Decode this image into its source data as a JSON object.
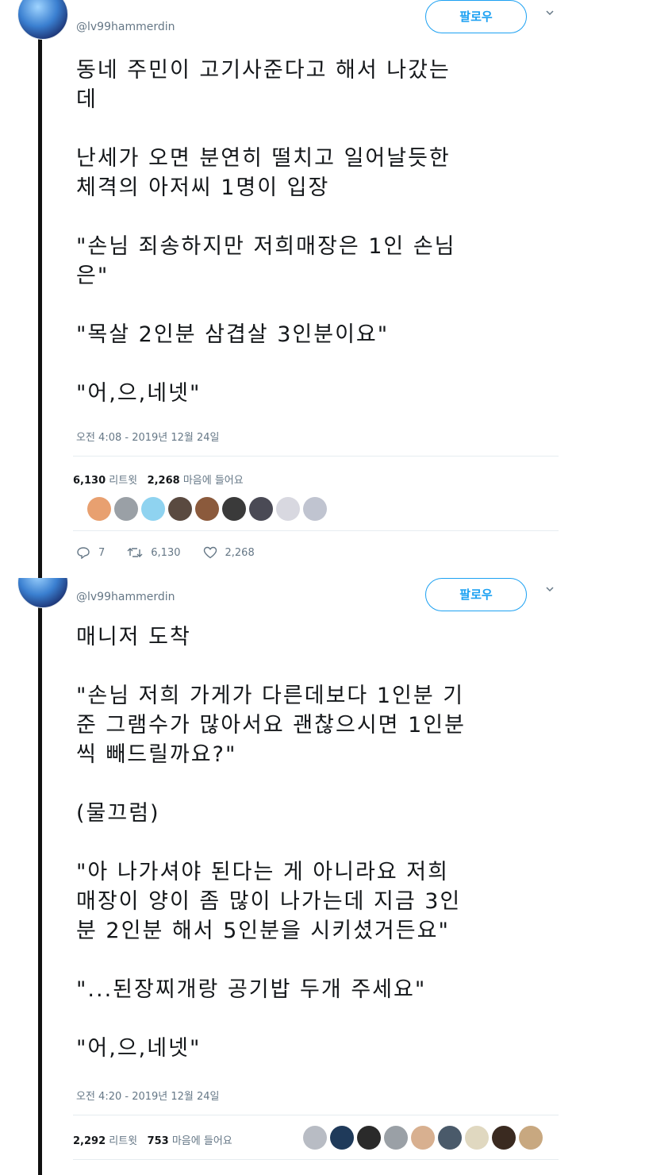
{
  "tweets": [
    {
      "handle": "@lv99hammerdin",
      "follow_label": "팔로우",
      "paragraphs": [
        "동네 주민이 고기사준다고 해서 나갔는\n데",
        "난세가 오면 분연히 떨치고 일어날듯한\n체격의 아저씨 1명이 입장",
        "\"손님 죄송하지만 저희매장은 1인 손님\n은\"",
        "\"목살 2인분 삼겹살 3인분이요\"",
        "\"어,으,네넷\""
      ],
      "timestamp": "오전 4:08 - 2019년 12월 24일",
      "stats": {
        "retweets": "6,130",
        "retweets_label": "리트윗",
        "likes": "2,268",
        "likes_label": "마음에 들어요"
      },
      "liker_colors": [
        "#e8a070",
        "#9aa0a6",
        "#8fd3f0",
        "#5a4a40",
        "#8b5a3c",
        "#3a3a3a",
        "#4a4a55",
        "#d8d8e0",
        "#c0c4d0"
      ],
      "actions": {
        "replies": "7",
        "retweets": "6,130",
        "likes": "2,268"
      }
    },
    {
      "handle": "@lv99hammerdin",
      "follow_label": "팔로우",
      "paragraphs": [
        "매니저 도착",
        "\"손님 저희 가게가 다른데보다 1인분 기\n준 그램수가 많아서요 괜찮으시면 1인분\n씩 빼드릴까요?\"",
        "(물끄럼)",
        "\"아 나가셔야 된다는 게 아니라요 저희\n매장이 양이 좀 많이 나가는데 지금 3인\n분 2인분 해서 5인분을 시키셨거든요\"",
        "\"...된장찌개랑 공기밥 두개 주세요\"",
        "\"어,으,네넷\""
      ],
      "timestamp": "오전 4:20 - 2019년 12월 24일",
      "stats": {
        "retweets": "2,292",
        "retweets_label": "리트윗",
        "likes": "753",
        "likes_label": "마음에 들어요"
      },
      "liker_colors": [
        "#b8bcc4",
        "#1f3a5a",
        "#2a2a2a",
        "#9aa0a6",
        "#d8b090",
        "#4a5a6a",
        "#e0d8c0",
        "#3a2a20",
        "#c8a880"
      ]
    }
  ]
}
